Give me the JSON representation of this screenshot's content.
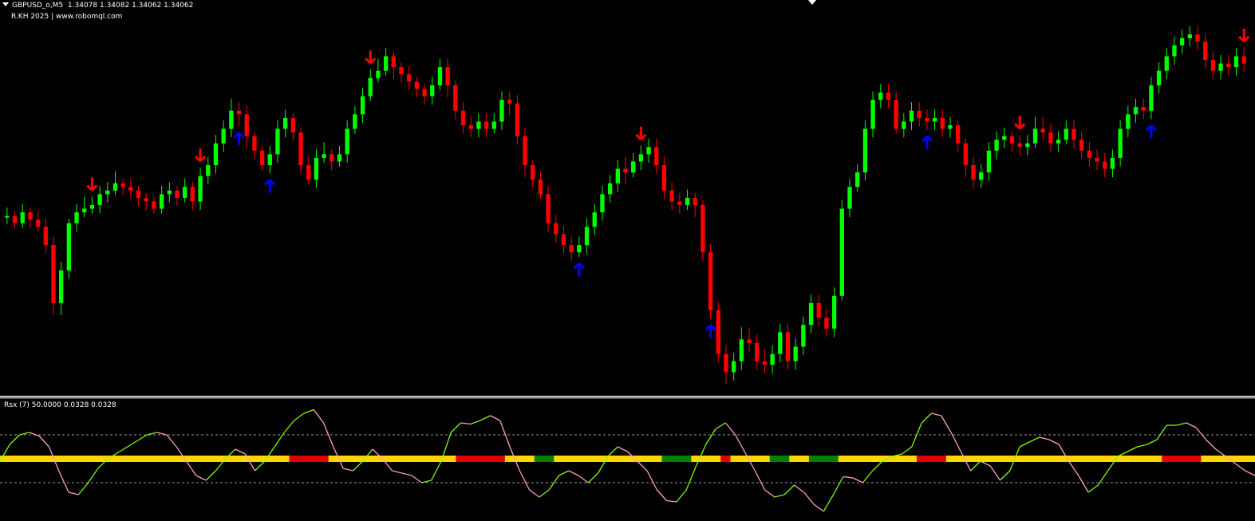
{
  "header": {
    "symbol": "GBPUSD_o,M5",
    "ohlc": "1.34078 1.34082 1.34062 1.34062",
    "credit": "R.KH 2025 | www.robomql.com"
  },
  "indicator": {
    "label": "Rsx (7) 50.0000 0.0328 0.0328"
  },
  "colors": {
    "background": "#000000",
    "bull": "#00ff00",
    "bear": "#ff0000",
    "buy_arrow": "#0000ff",
    "sell_arrow": "#ff0000",
    "rsx_up": "#7cfc00",
    "rsx_down": "#ff9ec7",
    "band_yellow": "#ffd700",
    "band_red": "#e00000",
    "band_green": "#008000"
  },
  "chart_data": {
    "type": "candlestick",
    "symbol": "GBPUSD_o",
    "timeframe": "M5",
    "candles": [
      [
        46.0,
        46.0,
        45.0,
        47.0
      ],
      [
        46.0,
        44.0,
        44.0,
        46.0
      ],
      [
        44.0,
        47.0,
        44.0,
        48.0
      ],
      [
        47.0,
        45.0,
        44.0,
        47.0
      ],
      [
        45.0,
        43.0,
        43.0,
        46.0
      ],
      [
        43.0,
        38.0,
        37.0,
        44.0
      ],
      [
        38.0,
        22.0,
        20.0,
        39.0
      ],
      [
        22.0,
        31.0,
        20.0,
        32.0
      ],
      [
        31.0,
        44.0,
        30.0,
        44.0
      ],
      [
        44.0,
        47.0,
        43.0,
        48.0
      ],
      [
        47.0,
        48.0,
        47.0,
        50.0
      ],
      [
        48.0,
        49.0,
        48.0,
        50.0
      ],
      [
        49.0,
        52.0,
        48.0,
        53.0
      ],
      [
        52.0,
        53.0,
        51.0,
        54.0
      ],
      [
        53.0,
        55.0,
        53.0,
        57.0
      ],
      [
        55.0,
        54.0,
        53.0,
        55.0
      ],
      [
        54.0,
        53.0,
        52.0,
        55.0
      ],
      [
        53.0,
        51.0,
        50.0,
        53.0
      ],
      [
        51.0,
        50.0,
        49.0,
        51.0
      ],
      [
        50.0,
        48.0,
        48.0,
        50.0
      ],
      [
        48.0,
        52.0,
        48.0,
        53.0
      ],
      [
        52.0,
        53.0,
        51.0,
        54.0
      ],
      [
        53.0,
        51.0,
        50.0,
        53.0
      ],
      [
        51.0,
        54.0,
        51.0,
        55.0
      ],
      [
        54.0,
        50.0,
        49.0,
        54.0
      ],
      [
        50.0,
        57.0,
        49.0,
        58.0
      ],
      [
        57.0,
        60.0,
        56.0,
        61.0
      ],
      [
        60.0,
        66.0,
        59.0,
        67.0
      ],
      [
        66.0,
        70.0,
        65.0,
        71.0
      ],
      [
        70.0,
        75.0,
        69.0,
        77.0
      ],
      [
        75.0,
        74.0,
        72.0,
        76.0
      ],
      [
        74.0,
        68.0,
        66.0,
        75.0
      ],
      [
        68.0,
        64.0,
        63.0,
        68.0
      ],
      [
        64.0,
        60.0,
        60.0,
        64.0
      ],
      [
        60.0,
        63.0,
        59.0,
        64.0
      ],
      [
        63.0,
        70.0,
        62.0,
        71.0
      ],
      [
        70.0,
        73.0,
        69.0,
        74.0
      ],
      [
        73.0,
        69.0,
        68.0,
        73.0
      ],
      [
        69.0,
        60.0,
        59.0,
        69.0
      ],
      [
        60.0,
        56.0,
        56.0,
        61.0
      ],
      [
        56.0,
        62.0,
        55.0,
        63.0
      ],
      [
        62.0,
        63.0,
        62.0,
        65.0
      ],
      [
        63.0,
        61.0,
        60.0,
        63.0
      ],
      [
        61.0,
        63.0,
        61.0,
        64.0
      ],
      [
        63.0,
        70.0,
        62.0,
        71.0
      ],
      [
        70.0,
        74.0,
        70.0,
        75.0
      ],
      [
        74.0,
        79.0,
        73.0,
        80.0
      ],
      [
        79.0,
        84.0,
        79.0,
        85.0
      ],
      [
        84.0,
        86.0,
        84.0,
        88.0
      ],
      [
        86.0,
        90.0,
        86.0,
        91.0
      ],
      [
        90.0,
        87.0,
        85.0,
        90.0
      ],
      [
        87.0,
        85.0,
        84.0,
        87.0
      ],
      [
        85.0,
        83.0,
        82.0,
        86.0
      ],
      [
        83.0,
        81.0,
        80.0,
        83.0
      ],
      [
        81.0,
        79.0,
        78.0,
        81.0
      ],
      [
        79.0,
        82.0,
        78.0,
        83.0
      ],
      [
        82.0,
        87.0,
        82.0,
        88.0
      ],
      [
        87.0,
        82.0,
        80.0,
        88.0
      ],
      [
        82.0,
        75.0,
        74.0,
        82.0
      ],
      [
        75.0,
        71.0,
        70.0,
        76.0
      ],
      [
        71.0,
        70.0,
        69.0,
        72.0
      ],
      [
        70.0,
        72.0,
        69.0,
        73.0
      ],
      [
        72.0,
        70.0,
        69.0,
        73.0
      ],
      [
        70.0,
        72.0,
        70.0,
        73.0
      ],
      [
        72.0,
        78.0,
        71.0,
        79.0
      ],
      [
        78.0,
        77.0,
        75.0,
        79.0
      ],
      [
        77.0,
        68.0,
        67.0,
        78.0
      ],
      [
        68.0,
        60.0,
        58.0,
        69.0
      ],
      [
        60.0,
        56.0,
        55.0,
        60.0
      ],
      [
        56.0,
        52.0,
        52.0,
        57.0
      ],
      [
        52.0,
        44.0,
        43.0,
        53.0
      ],
      [
        44.0,
        41.0,
        40.0,
        45.0
      ],
      [
        41.0,
        38.0,
        37.0,
        42.0
      ],
      [
        38.0,
        36.0,
        35.0,
        39.0
      ],
      [
        36.0,
        38.0,
        36.0,
        39.0
      ],
      [
        38.0,
        43.0,
        37.0,
        44.0
      ],
      [
        43.0,
        47.0,
        42.0,
        48.0
      ],
      [
        47.0,
        52.0,
        46.0,
        53.0
      ],
      [
        52.0,
        55.0,
        51.0,
        56.0
      ],
      [
        55.0,
        59.0,
        54.0,
        60.0
      ],
      [
        59.0,
        58.0,
        56.0,
        61.0
      ],
      [
        58.0,
        61.0,
        58.0,
        62.0
      ],
      [
        61.0,
        63.0,
        60.0,
        64.0
      ],
      [
        63.0,
        65.0,
        62.0,
        66.0
      ],
      [
        65.0,
        60.0,
        59.0,
        66.0
      ],
      [
        60.0,
        53.0,
        52.0,
        61.0
      ],
      [
        53.0,
        50.0,
        49.0,
        54.0
      ],
      [
        50.0,
        49.0,
        48.0,
        51.0
      ],
      [
        49.0,
        51.0,
        49.0,
        52.0
      ],
      [
        51.0,
        49.0,
        47.0,
        51.0
      ],
      [
        49.0,
        36.0,
        35.0,
        49.0
      ],
      [
        36.0,
        20.0,
        19.0,
        37.0
      ],
      [
        20.0,
        8.0,
        7.0,
        21.0
      ],
      [
        8.0,
        3.0,
        1.0,
        9.0
      ],
      [
        3.0,
        6.0,
        2.0,
        7.0
      ],
      [
        6.0,
        12.0,
        5.0,
        14.0
      ],
      [
        12.0,
        11.0,
        10.0,
        14.0
      ],
      [
        11.0,
        6.0,
        5.0,
        12.0
      ],
      [
        6.0,
        5.0,
        4.0,
        8.0
      ],
      [
        5.0,
        8.0,
        4.0,
        9.0
      ],
      [
        8.0,
        14.0,
        7.0,
        15.0
      ],
      [
        14.0,
        6.0,
        5.0,
        15.0
      ],
      [
        6.0,
        10.0,
        5.0,
        11.0
      ],
      [
        10.0,
        16.0,
        9.0,
        17.0
      ],
      [
        16.0,
        22.0,
        15.0,
        23.0
      ],
      [
        22.0,
        18.0,
        17.0,
        23.0
      ],
      [
        18.0,
        15.0,
        14.0,
        19.0
      ],
      [
        15.0,
        24.0,
        14.0,
        25.0
      ],
      [
        24.0,
        48.0,
        24.0,
        49.0
      ],
      [
        48.0,
        54.0,
        47.0,
        55.0
      ],
      [
        54.0,
        58.0,
        54.0,
        59.0
      ],
      [
        58.0,
        70.0,
        57.0,
        71.0
      ],
      [
        70.0,
        78.0,
        69.0,
        79.0
      ],
      [
        78.0,
        80.0,
        77.0,
        81.0
      ],
      [
        80.0,
        78.0,
        77.0,
        81.0
      ],
      [
        78.0,
        70.0,
        70.0,
        79.0
      ],
      [
        70.0,
        72.0,
        69.0,
        73.0
      ],
      [
        72.0,
        75.0,
        71.0,
        76.0
      ],
      [
        75.0,
        73.0,
        72.0,
        76.0
      ],
      [
        73.0,
        72.0,
        71.0,
        74.0
      ],
      [
        72.0,
        73.0,
        71.0,
        74.0
      ],
      [
        73.0,
        70.0,
        69.0,
        74.0
      ],
      [
        70.0,
        71.0,
        69.0,
        72.0
      ],
      [
        71.0,
        66.0,
        65.0,
        71.0
      ],
      [
        66.0,
        60.0,
        58.0,
        66.0
      ],
      [
        60.0,
        56.0,
        55.0,
        61.0
      ],
      [
        56.0,
        58.0,
        55.0,
        59.0
      ],
      [
        58.0,
        64.0,
        57.0,
        65.0
      ],
      [
        64.0,
        67.0,
        63.0,
        68.0
      ],
      [
        67.0,
        68.0,
        66.0,
        69.0
      ],
      [
        68.0,
        66.0,
        65.0,
        68.0
      ],
      [
        66.0,
        65.0,
        64.0,
        67.0
      ],
      [
        65.0,
        66.0,
        64.0,
        67.0
      ],
      [
        66.0,
        70.0,
        66.0,
        72.0
      ],
      [
        70.0,
        69.0,
        68.0,
        72.0
      ],
      [
        69.0,
        66.0,
        65.0,
        70.0
      ],
      [
        66.0,
        67.0,
        65.0,
        68.0
      ],
      [
        67.0,
        70.0,
        67.0,
        71.0
      ],
      [
        70.0,
        67.0,
        66.0,
        71.0
      ],
      [
        67.0,
        64.0,
        63.0,
        68.0
      ],
      [
        64.0,
        62.0,
        61.0,
        65.0
      ],
      [
        62.0,
        61.0,
        60.0,
        63.0
      ],
      [
        61.0,
        59.0,
        58.0,
        62.0
      ],
      [
        59.0,
        62.0,
        58.0,
        63.0
      ],
      [
        62.0,
        70.0,
        61.0,
        71.0
      ],
      [
        70.0,
        74.0,
        69.0,
        75.0
      ],
      [
        74.0,
        76.0,
        73.0,
        77.0
      ],
      [
        76.0,
        75.0,
        74.0,
        77.0
      ],
      [
        75.0,
        82.0,
        74.0,
        83.0
      ],
      [
        82.0,
        86.0,
        81.0,
        87.0
      ],
      [
        86.0,
        90.0,
        85.0,
        91.0
      ],
      [
        90.0,
        93.0,
        89.0,
        94.0
      ],
      [
        93.0,
        95.0,
        92.0,
        96.0
      ],
      [
        95.0,
        96.0,
        94.0,
        97.0
      ],
      [
        96.0,
        94.0,
        93.0,
        97.0
      ],
      [
        94.0,
        89.0,
        88.0,
        95.0
      ],
      [
        89.0,
        86.0,
        85.0,
        90.0
      ],
      [
        86.0,
        88.0,
        85.0,
        89.0
      ],
      [
        88.0,
        87.0,
        86.0,
        89.0
      ],
      [
        87.0,
        90.0,
        86.0,
        91.0
      ],
      [
        90.0,
        88.0,
        87.0,
        91.0
      ]
    ],
    "buy_arrows": [
      [
        30,
        "up"
      ],
      [
        74,
        "up"
      ],
      [
        91,
        "up"
      ],
      [
        119,
        "up"
      ],
      [
        148,
        "up"
      ],
      [
        34,
        "up"
      ]
    ],
    "sell_arrows": [
      [
        11,
        "down"
      ],
      [
        25,
        "down"
      ],
      [
        47,
        "down"
      ],
      [
        82,
        "down"
      ],
      [
        131,
        "down"
      ],
      [
        160,
        "down"
      ]
    ],
    "indicator": {
      "name": "Rsx (7)",
      "level": 50.0,
      "values": [
        0.0328,
        0.0328
      ],
      "levels": [
        70,
        30
      ],
      "line": [
        48,
        62,
        70,
        72,
        69,
        60,
        40,
        22,
        20,
        30,
        42,
        50,
        55,
        60,
        65,
        70,
        72,
        70,
        60,
        48,
        36,
        32,
        40,
        50,
        58,
        54,
        40,
        48,
        60,
        72,
        82,
        88,
        91,
        80,
        60,
        42,
        40,
        48,
        58,
        50,
        40,
        38,
        36,
        30,
        32,
        48,
        72,
        80,
        79,
        82,
        86,
        82,
        60,
        40,
        24,
        18,
        24,
        36,
        40,
        36,
        30,
        38,
        52,
        60,
        56,
        48,
        40,
        24,
        15,
        14,
        24,
        44,
        62,
        75,
        80,
        70,
        55,
        40,
        24,
        18,
        20,
        28,
        22,
        12,
        6,
        20,
        35,
        34,
        30,
        40,
        48,
        52,
        54,
        60,
        80,
        88,
        86,
        72,
        56,
        40,
        48,
        44,
        32,
        40,
        60,
        64,
        68,
        66,
        62,
        48,
        36,
        22,
        28,
        40,
        52,
        56,
        60,
        62,
        66,
        78,
        78,
        80,
        76,
        66,
        58,
        52,
        46,
        40,
        36
      ]
    }
  }
}
